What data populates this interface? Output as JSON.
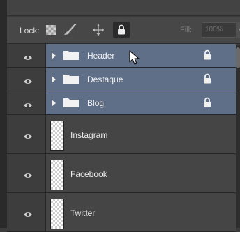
{
  "lock_toolbar": {
    "lock_label": "Lock:",
    "lock_transparent_icon": "checkerboard-icon",
    "lock_image_icon": "brush-icon",
    "lock_position_icon": "move-icon",
    "lock_all_icon": "padlock-icon",
    "fill_label": "Fill:",
    "fill_value": "100%"
  },
  "layers": [
    {
      "kind": "group",
      "name": "Header",
      "locked": true,
      "visible": true
    },
    {
      "kind": "group",
      "name": "Destaque",
      "locked": true,
      "visible": true
    },
    {
      "kind": "group",
      "name": "Blog",
      "locked": true,
      "visible": true
    },
    {
      "kind": "layer",
      "name": "Instagram",
      "visible": true
    },
    {
      "kind": "layer",
      "name": "Facebook",
      "visible": true
    },
    {
      "kind": "layer",
      "name": "Twitter",
      "visible": true
    }
  ],
  "colors": {
    "group_selected": "#5f6f87",
    "panel": "#454545"
  }
}
